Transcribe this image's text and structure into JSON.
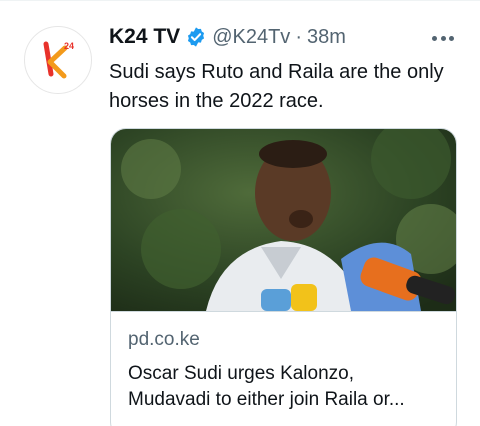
{
  "tweet": {
    "author": {
      "display_name": "K24 TV",
      "handle": "@K24Tv",
      "verified": true,
      "avatar_icon": "k24-logo-icon"
    },
    "separator": "·",
    "time": "38m",
    "more_icon": "more-options-icon",
    "text": "Sudi says Ruto and Raila are the only horses in the 2022 race."
  },
  "card": {
    "image_icon": "news-photo-speaker-at-microphones",
    "domain": "pd.co.ke",
    "title_line1": "Oscar Sudi urges Kalonzo,",
    "title_line2": "Mudavadi to either join Raila or..."
  },
  "colors": {
    "verified_badge": "#1d9bf0",
    "text_primary": "#0f1419",
    "text_secondary": "#536471",
    "border": "#cfd9de",
    "k24_red": "#e8322b",
    "k24_orange": "#f39a1b"
  }
}
